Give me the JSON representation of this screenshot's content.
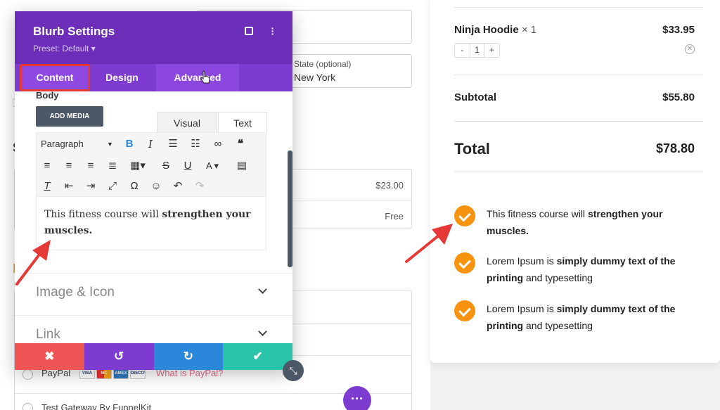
{
  "checkout": {
    "state_label": "State (optional)",
    "state_value": "New York",
    "shipping_prices": [
      "$23.00",
      "Free"
    ],
    "payment_methods": [
      "PayPal",
      "Test Gateway By FunnelKit"
    ],
    "paypal_link": "What is PayPal?",
    "card_logos": [
      "VISA",
      "MC",
      "AMEX",
      "DISCOVER"
    ]
  },
  "order_summary": {
    "item_name": "Ninja Hoodie",
    "item_qty_label": "× 1",
    "item_price": "$33.95",
    "stepper_minus": "-",
    "stepper_value": "1",
    "stepper_plus": "+",
    "subtotal_label": "Subtotal",
    "subtotal_value": "$55.80",
    "total_label": "Total",
    "total_value": "$78.80"
  },
  "blurbs": [
    {
      "plain": "This fitness course will ",
      "bold": "strengthen your muscles.",
      "tail": ""
    },
    {
      "plain": "Lorem Ipsum is ",
      "bold": "simply dummy text of the printing",
      "tail": " and typesetting"
    },
    {
      "plain": "Lorem Ipsum is ",
      "bold": "simply dummy text of the printing",
      "tail": " and typesetting"
    }
  ],
  "modal": {
    "title": "Blurb Settings",
    "preset": "Preset: Default ▾",
    "tabs": [
      "Content",
      "Design",
      "Advanced"
    ],
    "body_label": "Body",
    "add_media": "ADD MEDIA",
    "editor_tabs": [
      "Visual",
      "Text"
    ],
    "paragraph_select": "Paragraph",
    "editor_plain": "This fitness course will ",
    "editor_bold": "strengthen your muscles.",
    "sections": [
      "Image & Icon",
      "Link"
    ]
  },
  "colors": {
    "modal_header": "#6c2eb9",
    "tab_bar": "#7e3bd0",
    "check_orange": "#f7930f",
    "annotation_red": "#e53935",
    "cancel": "#ef5555",
    "undo": "#7d3bcf",
    "redo": "#2b87da",
    "save": "#29c4a9"
  }
}
